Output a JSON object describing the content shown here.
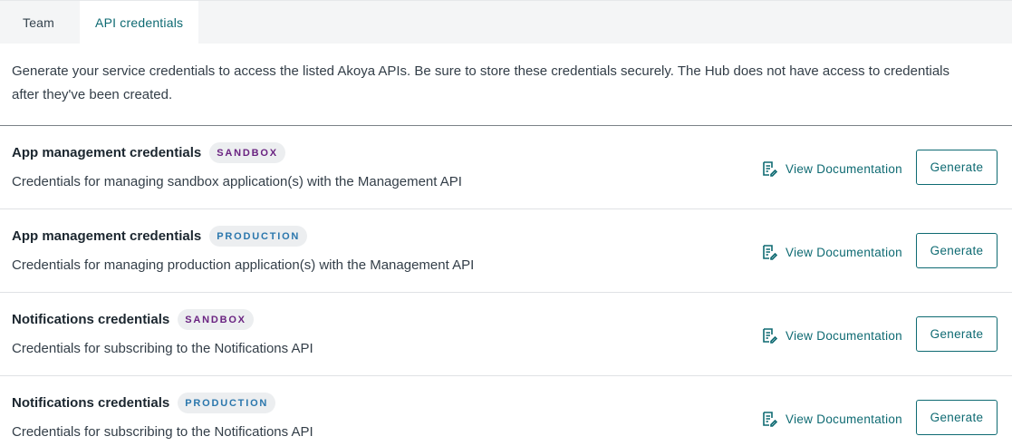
{
  "tabs": [
    {
      "label": "Team",
      "active": false
    },
    {
      "label": "API credentials",
      "active": true
    }
  ],
  "intro": "Generate your service credentials to access the listed Akoya APIs. Be sure to store these credentials securely. The Hub does not have access to credentials after they've been created.",
  "credentials": [
    {
      "title": "App management credentials",
      "badge": "SANDBOX",
      "description": "Credentials for managing sandbox application(s) with the Management API",
      "docs_label": "View Documentation",
      "button_label": "Generate"
    },
    {
      "title": "App management credentials",
      "badge": "PRODUCTION",
      "description": "Credentials for managing production application(s) with the Management API",
      "docs_label": "View Documentation",
      "button_label": "Generate"
    },
    {
      "title": "Notifications credentials",
      "badge": "SANDBOX",
      "description": "Credentials for subscribing to the Notifications API",
      "docs_label": "View Documentation",
      "button_label": "Generate"
    },
    {
      "title": "Notifications credentials",
      "badge": "PRODUCTION",
      "description": "Credentials for subscribing to the Notifications API",
      "docs_label": "View Documentation",
      "button_label": "Generate"
    }
  ],
  "icons": {
    "docs": "document-edit-icon"
  },
  "colors": {
    "accent": "#0e6a72",
    "sandbox_badge": "#6a2381",
    "production_badge": "#2b77ad"
  }
}
